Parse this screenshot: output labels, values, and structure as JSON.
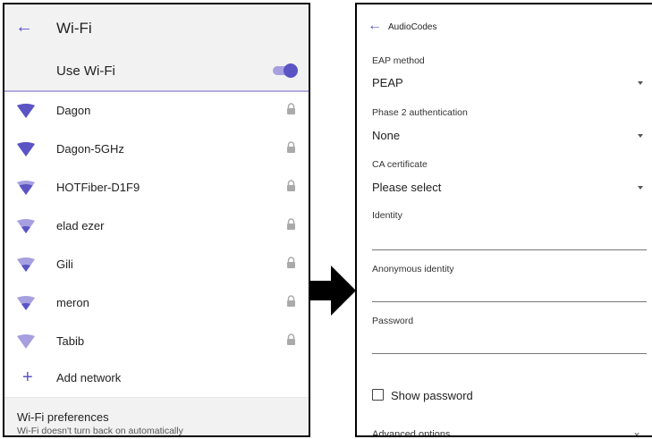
{
  "left": {
    "title": "Wi-Fi",
    "toggle_label": "Use Wi-Fi",
    "toggle_on": true,
    "networks": [
      {
        "name": "Dagon",
        "signal": 4,
        "locked": true
      },
      {
        "name": "Dagon-5GHz",
        "signal": 4,
        "locked": true
      },
      {
        "name": "HOTFiber-D1F9",
        "signal": 3,
        "locked": true
      },
      {
        "name": "elad ezer",
        "signal": 2,
        "locked": true
      },
      {
        "name": "Gili",
        "signal": 2,
        "locked": true
      },
      {
        "name": "meron",
        "signal": 2,
        "locked": true
      },
      {
        "name": "Tabib",
        "signal": 0,
        "locked": true
      }
    ],
    "add_network": "Add network",
    "prefs_title": "Wi-Fi preferences",
    "prefs_subtitle": "Wi-Fi doesn't turn back on automatically"
  },
  "right": {
    "title": "AudioCodes",
    "eap_label": "EAP method",
    "eap_value": "PEAP",
    "phase2_label": "Phase 2 authentication",
    "phase2_value": "None",
    "ca_label": "CA certificate",
    "ca_value": "Please select",
    "identity_label": "Identity",
    "identity_value": "",
    "anon_label": "Anonymous identity",
    "anon_value": "",
    "password_label": "Password",
    "password_value": "",
    "show_password": "Show password",
    "advanced": "Advanced options"
  },
  "colors": {
    "accent": "#5b54c4",
    "accent_light": "#a6a0e0",
    "appbar_bg": "#f2f2f2"
  }
}
